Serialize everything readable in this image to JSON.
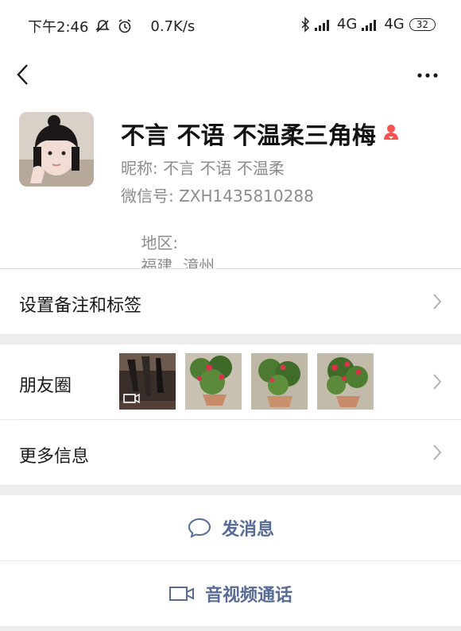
{
  "status_bar": {
    "time": "下午2:46",
    "speed": "0.7K/s",
    "network1": "4G",
    "network2": "4G",
    "battery": "32"
  },
  "profile": {
    "name": "不言 不语 不温柔三角梅",
    "nickname_label": "昵称:",
    "nickname": "不言 不语 不温柔",
    "wechat_id_label": "微信号:",
    "wechat_id": "ZXH1435810288",
    "region_label": "地区:",
    "region": "福建  漳州"
  },
  "rows": {
    "remark_tags": "设置备注和标签",
    "moments": "朋友圈",
    "more_info": "更多信息"
  },
  "actions": {
    "send_message": "发消息",
    "video_call": "音视频通话"
  },
  "colors": {
    "link_blue": "#576b95",
    "gender_icon": "#fa5151"
  }
}
